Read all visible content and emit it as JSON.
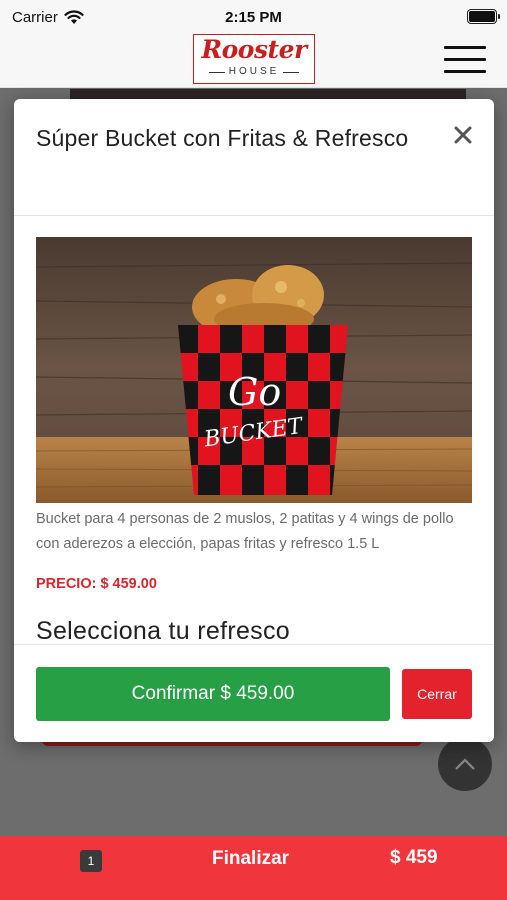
{
  "status_bar": {
    "carrier": "Carrier",
    "time": "2:15 PM"
  },
  "header": {
    "logo_main": "Rooster",
    "logo_sub": "HOUSE"
  },
  "modal": {
    "title": "Súper Bucket con Fritas & Refresco",
    "image_text_top": "Go",
    "image_text_bottom": "BUCKET",
    "description": "Bucket para 4 personas de 2 muslos, 2 patitas y 4 wings de pollo con aderezos a elección, papas fritas y refresco 1.5 L",
    "price": "PRECIO: $ 459.00",
    "select_heading": "Selecciona tu refresco",
    "confirm_label": "Confirmar $ 459.00",
    "close_label": "Cerrar"
  },
  "bottom_bar": {
    "cart_count": "1",
    "finalize_label": "Finalizar",
    "total": "$ 459"
  },
  "colors": {
    "brand_red": "#c81e1e",
    "confirm_green": "#27a045",
    "close_red": "#e4222e",
    "bottom_bar_red": "#f1353c",
    "price_red": "#d9262c"
  },
  "icons": [
    "wifi-icon",
    "battery-icon",
    "menu-icon",
    "close-icon",
    "chevron-up-icon"
  ]
}
